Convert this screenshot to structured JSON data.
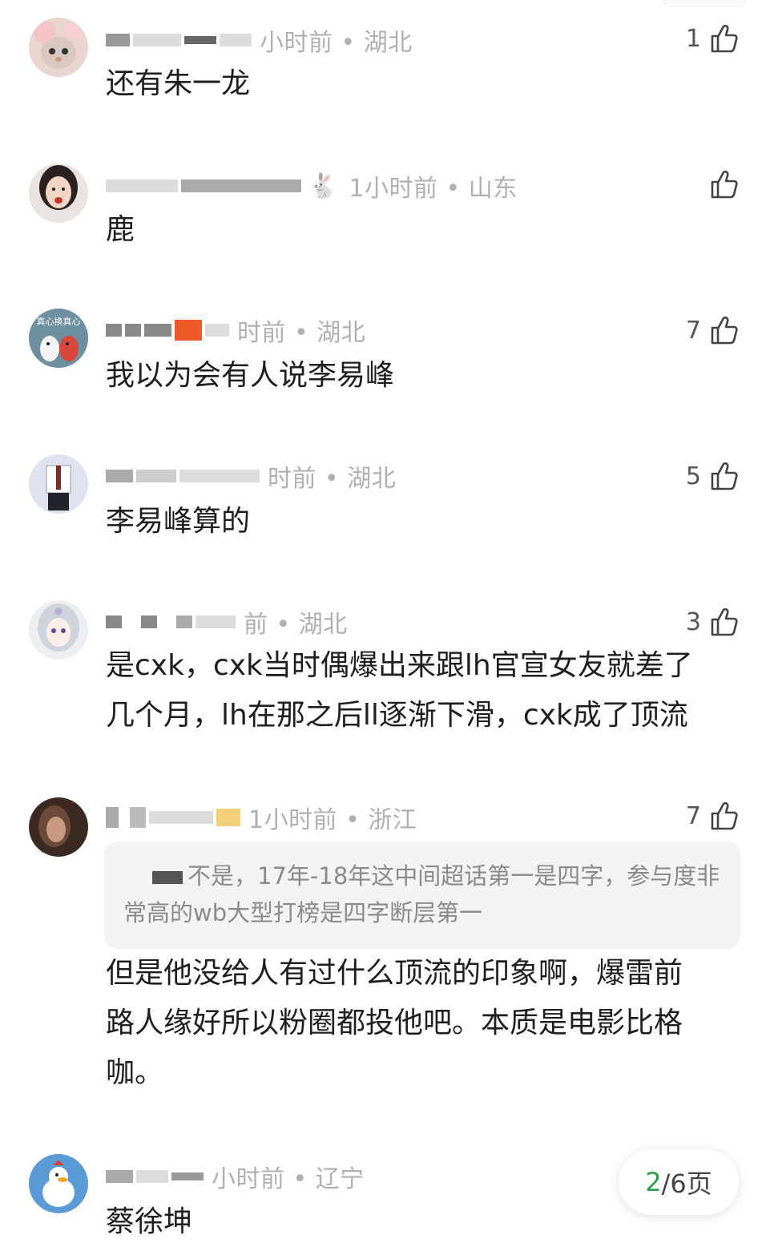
{
  "comments": [
    {
      "meta": "小时前 • 湖北",
      "likes": "1",
      "text": "还有朱一龙",
      "avatar": "cat-avatar"
    },
    {
      "meta": "1小时前 • 山东",
      "likes": "",
      "text": "鹿",
      "avatar": "girl-avatar"
    },
    {
      "meta": "时前 • 湖北",
      "likes": "7",
      "text": "我以为会有人说李易峰",
      "avatar": "duck-avatar"
    },
    {
      "meta": "时前 • 湖北",
      "likes": "5",
      "text": "李易峰算的",
      "avatar": "uniform-avatar"
    },
    {
      "meta": "前 • 湖北",
      "likes": "3",
      "text_lines": [
        "是cxk，cxk当时偶爆出来跟lh官宣女友就差了",
        "几个月，lh在那之后ll逐渐下滑，cxk成了顶流"
      ],
      "avatar": "anime-avatar"
    },
    {
      "meta": "1小时前 • 浙江",
      "likes": "7",
      "quote": "不是，17年-18年这中间超话第一是四字，参与度非常高的wb大型打榜是四字断层第一",
      "text_lines": [
        "但是他没给人有过什么顶流的印象啊，爆雷前",
        "路人缘好所以粉圈都投他吧。本质是电影比格",
        "咖。"
      ],
      "avatar": "dark-avatar"
    },
    {
      "meta": "小时前 • 辽宁",
      "likes": "",
      "text": "蔡徐坤",
      "avatar": "goose-avatar"
    }
  ],
  "pager": {
    "current": "2",
    "total": "/6页"
  },
  "colors": {
    "pager_current": "#2e9e4b",
    "meta": "#b0b0b0"
  }
}
